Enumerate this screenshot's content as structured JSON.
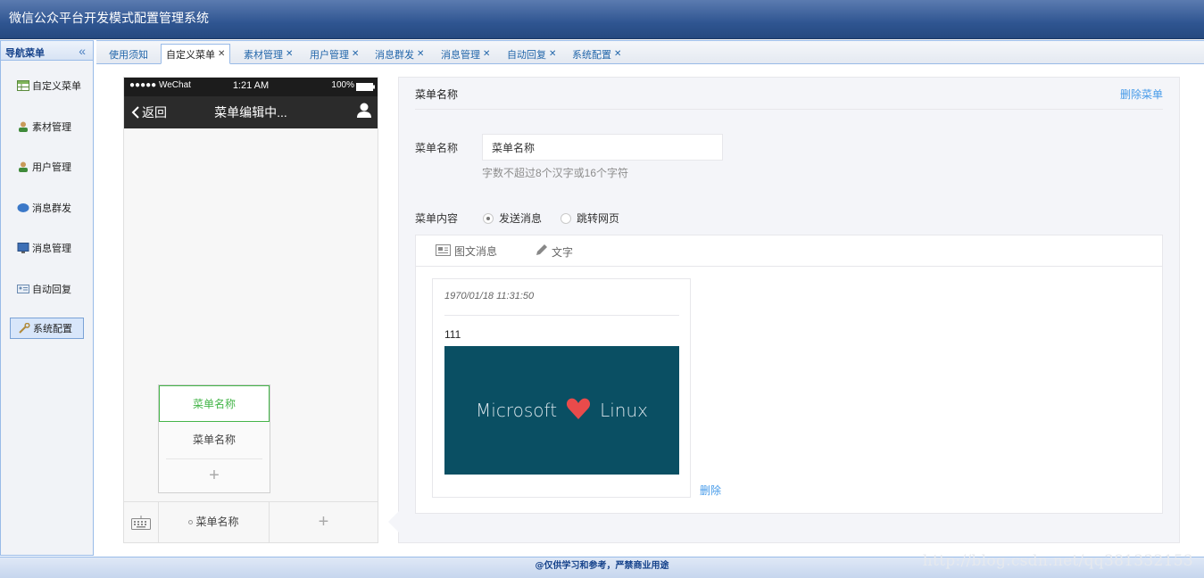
{
  "app": {
    "title": "微信公众平台开发模式配置管理系统"
  },
  "sidebar": {
    "header": "导航菜单",
    "items": [
      {
        "label": "自定义菜单",
        "icon": "table-icon"
      },
      {
        "label": "素材管理",
        "icon": "user-icon"
      },
      {
        "label": "用户管理",
        "icon": "user-icon"
      },
      {
        "label": "消息群发",
        "icon": "bubble-icon"
      },
      {
        "label": "消息管理",
        "icon": "monitor-icon"
      },
      {
        "label": "自动回复",
        "icon": "card-icon"
      },
      {
        "label": "系统配置",
        "icon": "wrench-icon"
      }
    ],
    "active": "系统配置"
  },
  "tabs": [
    {
      "label": "使用须知",
      "closable": false
    },
    {
      "label": "自定义菜单",
      "closable": true
    },
    {
      "label": "素材管理",
      "closable": true
    },
    {
      "label": "用户管理",
      "closable": true
    },
    {
      "label": "消息群发",
      "closable": true
    },
    {
      "label": "消息管理",
      "closable": true
    },
    {
      "label": "自动回复",
      "closable": true
    },
    {
      "label": "系统配置",
      "closable": true
    }
  ],
  "active_tab": "自定义菜单",
  "phone": {
    "signal": "●●●●● WeChat",
    "time": "1:21 AM",
    "battery": "100%",
    "back": "返回",
    "title": "菜单编辑中...",
    "submenu": [
      "菜单名称",
      "菜单名称"
    ],
    "submenu_add": "+",
    "main_menu": "菜单名称",
    "main_add": "+"
  },
  "editor": {
    "header": "菜单名称",
    "delete_menu": "删除菜单",
    "name_label": "菜单名称",
    "name_value": "菜单名称",
    "name_hint": "字数不超过8个汉字或16个字符",
    "content_label": "菜单内容",
    "radio_send": "发送消息",
    "radio_jump": "跳转网页",
    "selected_radio": "发送消息",
    "content_tabs": [
      "图文消息",
      "文字"
    ],
    "card": {
      "date": "1970/01/18 11:31:50",
      "title": "111",
      "cover_left": "Microsoft",
      "cover_right": "Linux"
    },
    "card_delete": "删除"
  },
  "footer": {
    "text": "@仅供学习和参考，严禁商业用途",
    "watermark": "http://blog.csdn.net/qq381332153"
  }
}
